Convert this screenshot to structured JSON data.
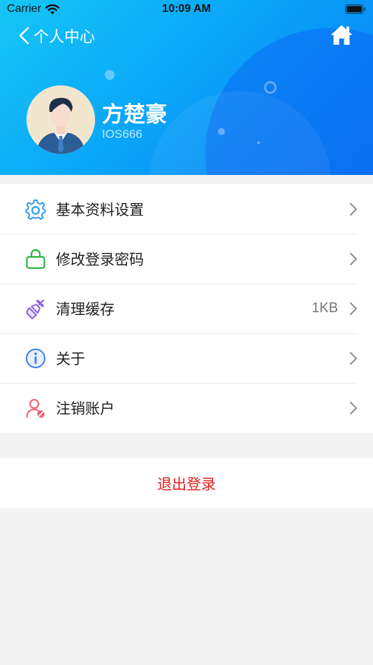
{
  "status_bar": {
    "carrier": "Carrier",
    "time": "10:09 AM"
  },
  "nav": {
    "title": "个人中心",
    "back_icon": "chevron-left-icon",
    "home_icon": "home-icon"
  },
  "profile": {
    "name": "方楚豪",
    "user_id": "IOS666",
    "avatar_icon": "businessman-avatar"
  },
  "menu": [
    {
      "label": "基本资料设置",
      "icon": "gear-icon",
      "value": "",
      "icon_color": "#2a9cf0"
    },
    {
      "label": "修改登录密码",
      "icon": "lock-icon",
      "value": "",
      "icon_color": "#27b43a"
    },
    {
      "label": "清理缓存",
      "icon": "brush-icon",
      "value": "1KB",
      "icon_color": "#8a5ce0"
    },
    {
      "label": "关于",
      "icon": "info-icon",
      "value": "",
      "icon_color": "#3c7ee8"
    },
    {
      "label": "注销账户",
      "icon": "user-cancel-icon",
      "value": "",
      "icon_color": "#f0616b"
    }
  ],
  "logout": {
    "label": "退出登录",
    "color": "#e8201b"
  },
  "colors": {
    "header_start": "#16c6f6",
    "header_end": "#0b7cf5",
    "background": "#f4f4f4"
  }
}
